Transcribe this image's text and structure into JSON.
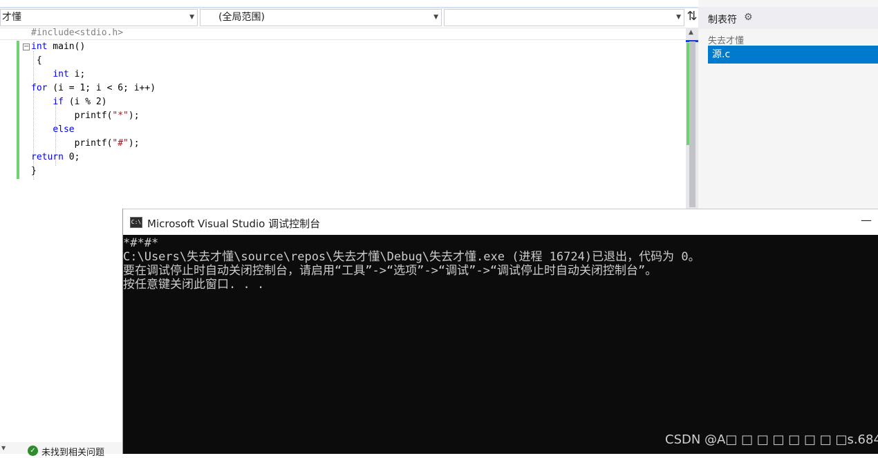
{
  "topbar": {
    "project_dropdown": "才懂",
    "scope_dropdown": "(全局范围)",
    "member_dropdown": "",
    "dropdown_arrow": "▼",
    "split_glyph": "⇅"
  },
  "editor": {
    "code_lines": [
      "#include<stdio.h>",
      "int main()",
      " {",
      "    int i;",
      "for (i = 1; i < 6; i++)",
      "    if (i % 2)",
      "        printf(\"*\");",
      "    else",
      "        printf(\"#\");",
      "return 0;",
      "}"
    ],
    "fold_glyph": "−"
  },
  "side_panel": {
    "toolbar_label": "制表符",
    "gear": "⚙",
    "project_name": "失去才懂",
    "selected_file": "源.c"
  },
  "status": {
    "message": "未找到相关问题",
    "check_glyph": "✓"
  },
  "console": {
    "icon_text": "C:\\",
    "title": "Microsoft Visual Studio 调试控制台",
    "minimize_glyph": "—",
    "output_lines": [
      "*#*#*",
      "C:\\Users\\失去才懂\\source\\repos\\失去才懂\\Debug\\失去才懂.exe (进程 16724)已退出，代码为 0。",
      "要在调试停止时自动关闭控制台，请启用“工具”->“选项”->“调试”->“调试停止时自动关闭控制台”。",
      "按任意键关闭此窗口. . ."
    ]
  },
  "watermark": "CSDN @A□ □ □ □ □ □ □ □s.684",
  "colors": {
    "accent": "#007acc",
    "keyword": "#0000ff",
    "string": "#a31515",
    "preprocessor": "#808080",
    "change_bar": "#6fd36f"
  }
}
